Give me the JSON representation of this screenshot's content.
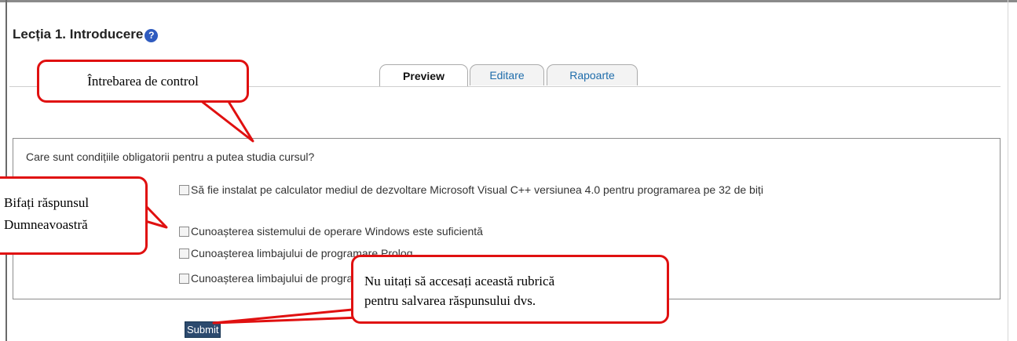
{
  "page": {
    "title": "Lecția 1. Introducere",
    "help_icon": "?"
  },
  "tabs": [
    {
      "label": "Preview",
      "active": true
    },
    {
      "label": "Editare",
      "active": false
    },
    {
      "label": "Rapoarte",
      "active": false
    }
  ],
  "question": {
    "text": "Care sunt condițiile obligatorii pentru a putea studia cursul?",
    "options": [
      {
        "label": "Să fie instalat pe calculator mediul de dezvoltare Microsoft Visual C++ versiunea 4.0 pentru programarea pe 32 de biți",
        "checked": false
      },
      {
        "label": "Cunoașterea sistemului de operare Windows este suficientă",
        "checked": false
      },
      {
        "label": "Cunoașterea limbajului de programare Prolog",
        "checked": false
      },
      {
        "label": "Cunoașterea limbajului de programare C++ și a sistemului de operare Windows",
        "checked": false
      }
    ]
  },
  "submit_label": "Submit",
  "callouts": {
    "control_question": "Întrebarea de control",
    "check_answer_line1": "Bifați răspunsul",
    "check_answer_line2": "Dumneavoastră",
    "remember_line1": "Nu uitați să accesați această rubrică",
    "remember_line2": "pentru salvarea răspunsului dvs."
  },
  "colors": {
    "callout_border": "#e01010",
    "link": "#1f6dab",
    "submit_bg": "#2c4a6e"
  }
}
